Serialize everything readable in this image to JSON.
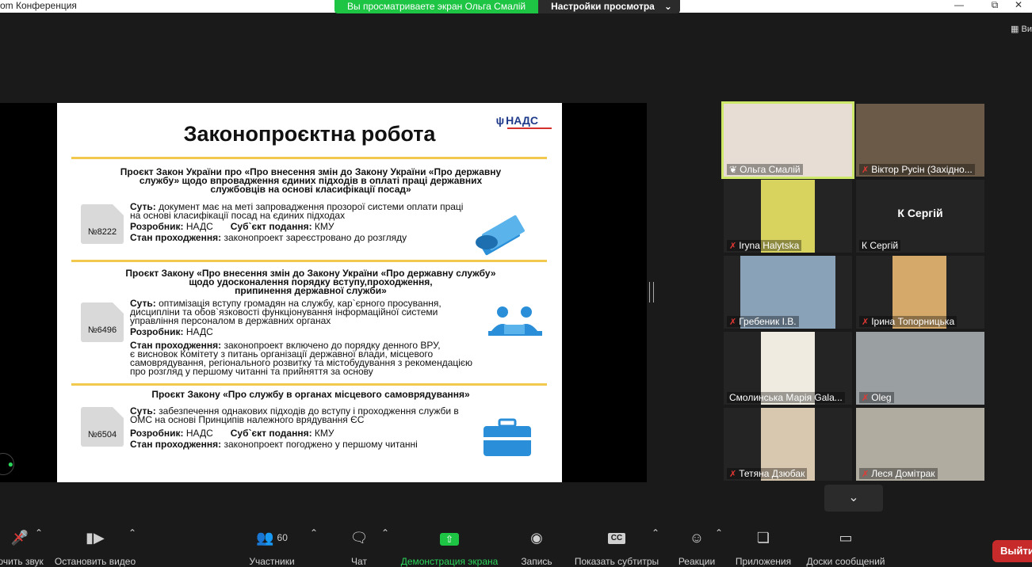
{
  "window": {
    "app_title": "om Конференция",
    "viewing_text": "Вы просматриваете экран Ольга Смалій",
    "view_settings_label": "Настройки просмотра",
    "view_option": "Ви"
  },
  "slide": {
    "logo": "НАДС",
    "title": "Законопроєктна робота",
    "projects": [
      {
        "title_lines": [
          "Проєкт Закон України про «Про внесення змін до Закону України «Про державну",
          "службу» щодо впровадження єдиних підходів в оплаті праці державних",
          "службовців на основі класифікації посад»"
        ],
        "number": "№8222",
        "essence_label": "Суть:",
        "essence_lines": [
          "документ має на меті запровадження прозорої системи оплати праці",
          "на основі класифікації посад на єдиних підходах"
        ],
        "developer_label": "Розробник:",
        "developer": "НАДС",
        "subject_label": "Суб`єкт подання:",
        "subject": "КМУ",
        "status_label": "Стан проходження:",
        "status_lines": [
          "законопроект  зареєстровано до розгляду"
        ]
      },
      {
        "title_lines": [
          "Проєкт Закону «Про внесення змін до Закону України «Про державну службу»",
          "щодо удосконалення порядку вступу,проходження,",
          "припинення державної служби»"
        ],
        "number": "№6496",
        "essence_label": "Суть:",
        "essence_lines": [
          "оптимізація вступу громадян на службу, кар`єрного просування,",
          "дисципліни та обов`язковості функціонування інформаційної системи",
          "управління персоналом  в державних органах"
        ],
        "developer_label": "Розробник:",
        "developer": "НАДС",
        "status_label": "Стан проходження:",
        "status_lines": [
          "законопроект включено до порядку денного ВРУ,",
          "є висновок Комітету з питань організації державної влади, місцевого",
          "самоврядування, регіонального розвитку та містобудування з рекомендацією",
          "про розгляд у першому читанні та прийняття за основу"
        ]
      },
      {
        "title_lines": [
          "Проєкт Закону «Про службу в органах місцевого самоврядування»"
        ],
        "number": "№6504",
        "essence_label": "Суть:",
        "essence_lines": [
          "забезпечення однакових підходів до вступу і проходження служби в",
          "ОМС на основі Принципів належного врядування ЄС"
        ],
        "developer_label": "Розробник:",
        "developer": "НАДС",
        "subject_label": "Суб`єкт подання:",
        "subject": "КМУ",
        "status_label": "Стан проходження:",
        "status_lines": [
          "законопроект погоджено у першому читанні"
        ]
      }
    ]
  },
  "participants": [
    {
      "name": "Ольга Смалій",
      "muted": false,
      "pinned": true,
      "active": true,
      "bg": "#e7ddd4"
    },
    {
      "name": "Віктор Русін (Західно...",
      "muted": true,
      "bg": "#6b5a48"
    },
    {
      "name": "Iryna Halytska",
      "muted": true,
      "bg": "#d8d25e"
    },
    {
      "name": "К Сергій",
      "display": "К Сергій",
      "muted": false,
      "bg": "#242424"
    },
    {
      "name": "Гребеник І.В.",
      "muted": true,
      "bg": "#8aa2b8"
    },
    {
      "name": "Ірина Топорницька",
      "muted": true,
      "bg": "#d4a96a"
    },
    {
      "name": "Смолинська Марія Gala...",
      "muted": false,
      "bg": "#f0ebe0"
    },
    {
      "name": "Oleg",
      "muted": true,
      "bg": "#9a9fa2"
    },
    {
      "name": "Тетяна Дзюбак",
      "muted": true,
      "bg": "#d9c8b0"
    },
    {
      "name": "Леся Домітрак",
      "muted": true,
      "bg": "#b0ada0"
    }
  ],
  "toolbar": {
    "mute": "ючить звук",
    "video": "Остановить видео",
    "participants": "Участники",
    "participants_count": "60",
    "chat": "Чат",
    "share": "Демонстрация экрана",
    "record": "Запись",
    "subtitles": "Показать субтитры",
    "subtitles_icon": "CC",
    "reactions": "Реакции",
    "apps": "Приложения",
    "whiteboard": "Доски сообщений",
    "leave": "Выйти"
  }
}
